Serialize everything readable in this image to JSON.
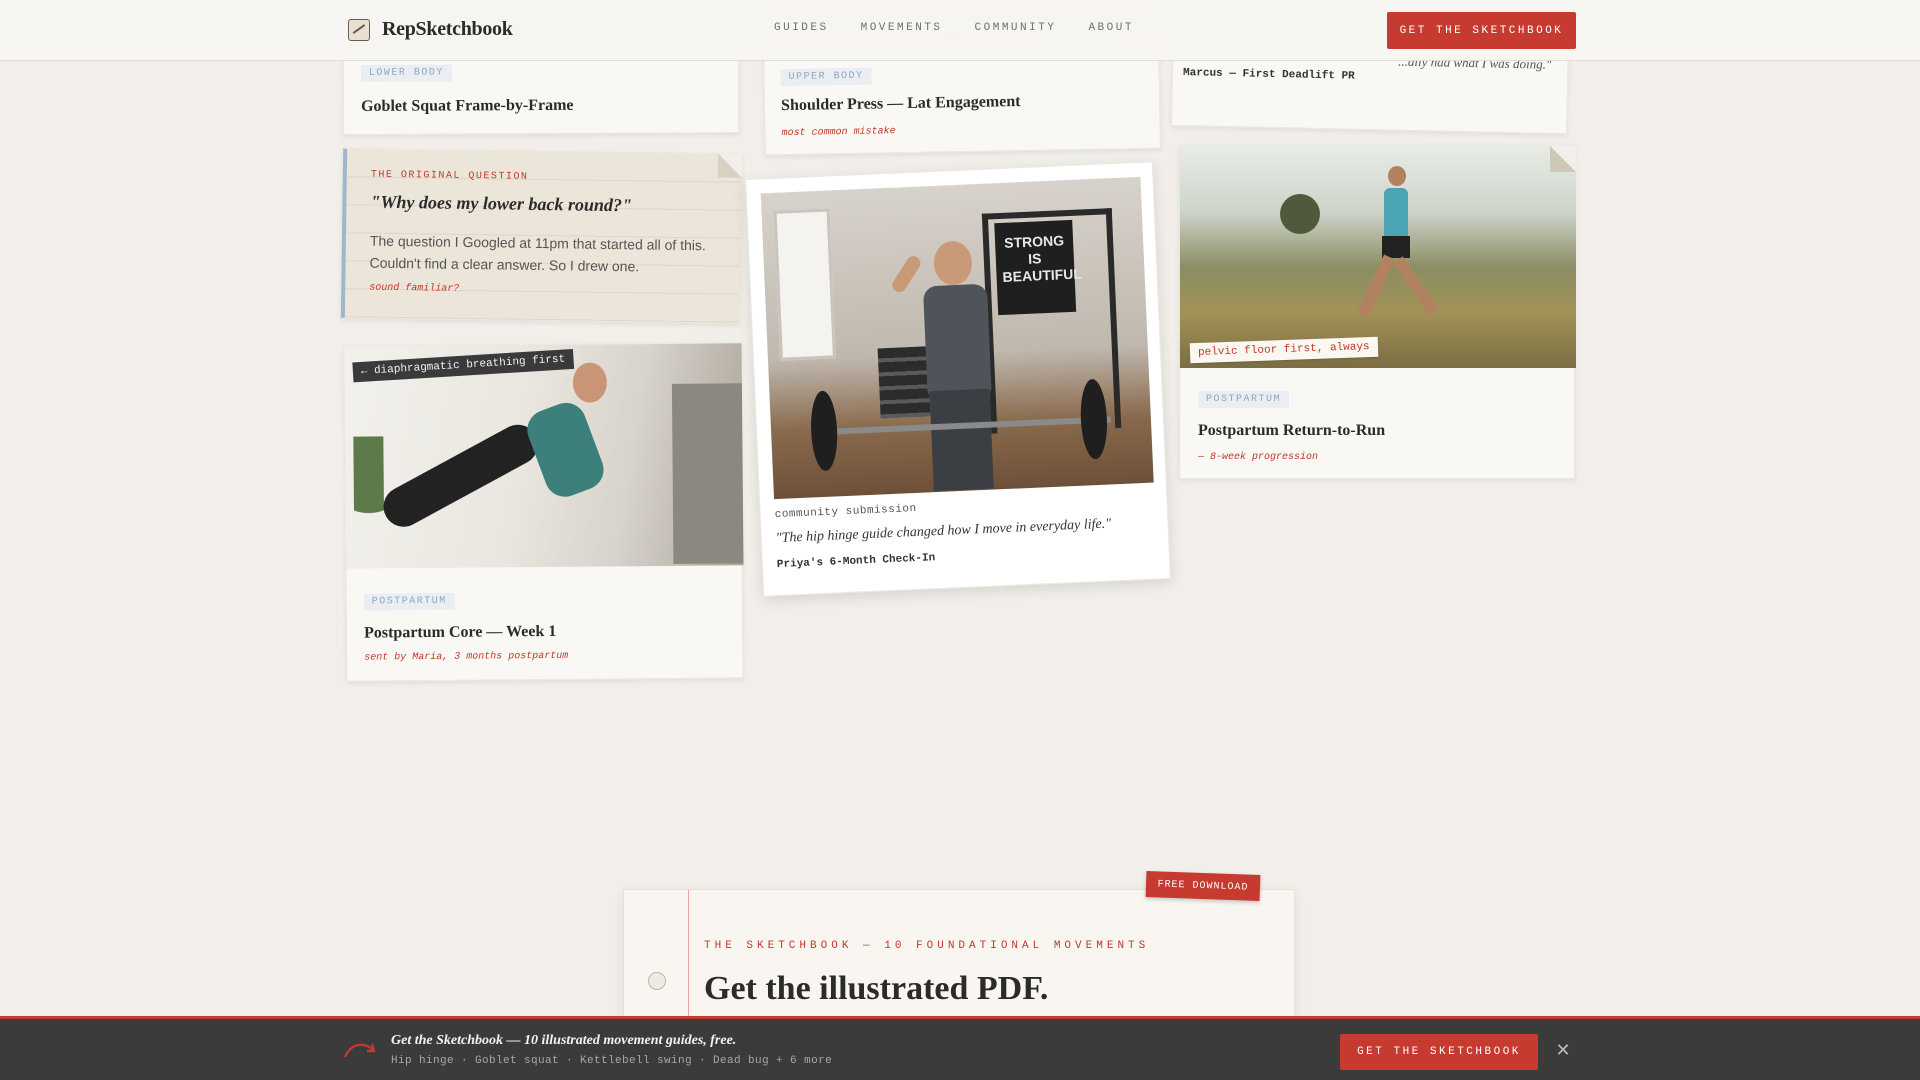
{
  "header": {
    "logo_text": "RepSketchbook",
    "nav": [
      "GUIDES",
      "MOVEMENTS",
      "COMMUNITY",
      "ABOUT"
    ],
    "cta": "GET THE SKETCHBOOK"
  },
  "cards": {
    "goblet": {
      "tag": "LOWER BODY",
      "title": "Goblet Squat Frame-by-Frame"
    },
    "shoulder": {
      "tag": "UPPER BODY",
      "title": "Shoulder Press — Lat Engagement",
      "note": "most common mistake"
    },
    "marcus": {
      "quote_fragment": "...ally had what I was doing.\"",
      "caption": "Marcus — First Deadlift PR"
    },
    "question": {
      "label": "THE ORIGINAL QUESTION",
      "quote": "\"Why does my lower back round?\"",
      "body": "The question I Googled at 11pm that started all of this. Couldn't find a clear answer. So I drew one.",
      "note": "sound familiar?"
    },
    "priya": {
      "poster_text": "STRONG IS BEAUTIFUL",
      "label": "community submission",
      "quote": "\"The hip hinge guide changed how I move in everyday life.\"",
      "caption": "Priya's 6-Month Check-In"
    },
    "run": {
      "photo_label": "pelvic floor first, always",
      "tag": "POSTPARTUM",
      "title": "Postpartum Return-to-Run",
      "note": "— 8-week progression"
    },
    "core": {
      "photo_label": "← diaphragmatic breathing first",
      "tag": "POSTPARTUM",
      "title": "Postpartum Core — Week 1",
      "note": "sent by Maria, 3 months postpartum"
    }
  },
  "sketchbook": {
    "badge": "FREE DOWNLOAD",
    "eyebrow": "THE SKETCHBOOK — 10 FOUNDATIONAL MOVEMENTS",
    "title": "Get the illustrated PDF."
  },
  "sticky": {
    "title": "Get the Sketchbook — 10 illustrated movement guides, free.",
    "subtitle": "Hip hinge · Goblet squat · Kettlebell swing · Dead bug + 6 more",
    "cta": "GET THE SKETCHBOOK",
    "close_icon": "close-icon"
  },
  "colors": {
    "accent": "#c63a2f",
    "background": "#f2efea",
    "tag_blue": "#8aa7c2"
  }
}
